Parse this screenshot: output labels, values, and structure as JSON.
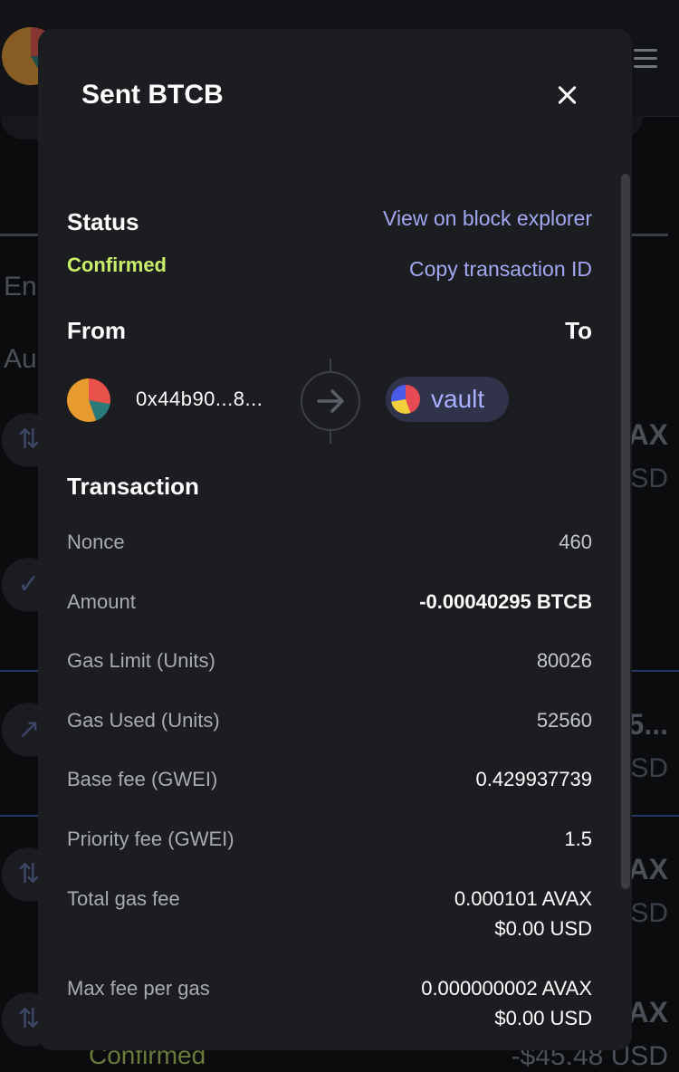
{
  "background": {
    "tab_partial_1": "En",
    "tab_partial_2": "Au",
    "right_1": "AX",
    "right_1_sub": "SD",
    "right_2": "5...",
    "right_2_sub": "SD",
    "right_3": "AX",
    "right_3_sub": "SD",
    "right_4": "AX",
    "bottom_status": "Confirmed",
    "bottom_amount": "-$45.48 USD"
  },
  "modal": {
    "title": "Sent BTCB",
    "status": {
      "heading": "Status",
      "value": "Confirmed",
      "view_explorer": "View on block explorer",
      "copy_id": "Copy transaction ID"
    },
    "from_heading": "From",
    "to_heading": "To",
    "from_address": "0x44b90...8...",
    "to_label": "vault",
    "transaction": {
      "heading": "Transaction",
      "nonce_label": "Nonce",
      "nonce_value": "460",
      "amount_label": "Amount",
      "amount_value": "-0.00040295 BTCB",
      "gas_limit_label": "Gas Limit (Units)",
      "gas_limit_value": "80026",
      "gas_used_label": "Gas Used (Units)",
      "gas_used_value": "52560",
      "base_fee_label": "Base fee (GWEI)",
      "base_fee_value": "0.429937739",
      "priority_fee_label": "Priority fee (GWEI)",
      "priority_fee_value": "1.5",
      "total_gas_label": "Total gas fee",
      "total_gas_value": "0.000101 AVAX",
      "total_gas_usd": "$0.00 USD",
      "max_fee_label": "Max fee per gas",
      "max_fee_value": "0.000000002 AVAX",
      "max_fee_usd": "$0.00 USD"
    }
  },
  "colors": {
    "modal_bg": "#1c1d21",
    "confirmed": "#c9ef6a",
    "link": "#a2a8f2",
    "pill": "#30334a"
  }
}
